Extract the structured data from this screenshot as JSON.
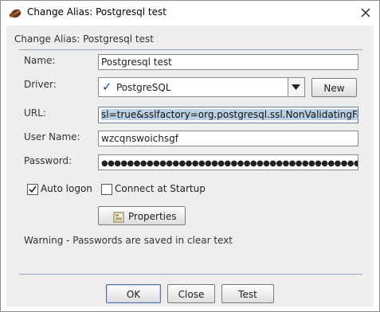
{
  "window": {
    "title": "Change Alias: Postgresql test"
  },
  "header": {
    "title": "Change Alias: Postgresql test"
  },
  "form": {
    "name_label": "Name:",
    "name_value": "Postgresql test",
    "driver_label": "Driver:",
    "driver_value": "PostgreSQL",
    "new_label": "New",
    "url_label": "URL:",
    "url_value": "sl=true&sslfactory=org.postgresql.ssl.NonValidatingFactory",
    "username_label": "User Name:",
    "username_value": "wzcqnswoichsgf",
    "password_label": "Password:",
    "password_mask": "●●●●●●●●●●●●●●●●●●●●●●●●●●●●●●●●●●●●●●●●●●●●●●●●●●●●",
    "auto_logon_label": "Auto logon",
    "auto_logon_checked": true,
    "connect_startup_label": "Connect at Startup",
    "connect_startup_checked": false,
    "properties_label": "Properties",
    "warning": "Warning - Passwords are saved in clear text"
  },
  "buttons": {
    "ok": "OK",
    "close": "Close",
    "test": "Test"
  },
  "icons": {
    "app": "coffee-bean-icon",
    "close": "close-icon",
    "driver_status": "checkmark-icon",
    "dropdown": "chevron-down-icon",
    "properties": "properties-icon"
  },
  "colors": {
    "selection": "#b8cfe5",
    "separator": "#9aa8c7",
    "check": "#1b3fa8"
  }
}
